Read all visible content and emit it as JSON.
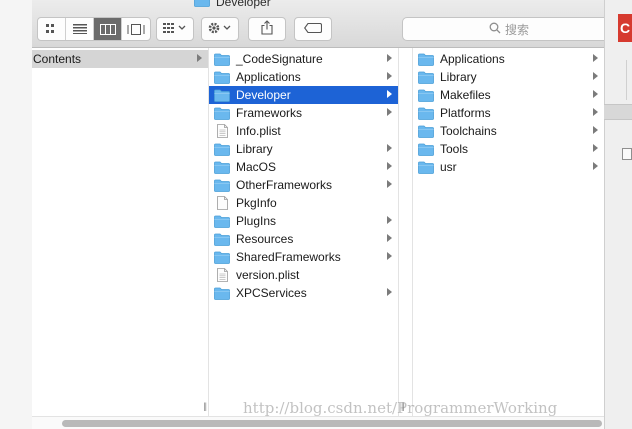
{
  "window": {
    "title": "Developer"
  },
  "toolbar": {
    "view_buttons": [
      {
        "icon": "icon-view-icon",
        "active": false
      },
      {
        "icon": "list-view-icon",
        "active": false
      },
      {
        "icon": "column-view-icon",
        "active": true
      },
      {
        "icon": "gallery-view-icon",
        "active": false
      }
    ],
    "arrange_icon": "group-arrange-icon",
    "action_icon": "gear-icon",
    "share_icon": "share-icon",
    "tag_icon": "tag-icon",
    "search": {
      "placeholder": "搜索",
      "icon": "search-icon"
    }
  },
  "columns": [
    {
      "items": [
        {
          "name": "Contents",
          "type": "folder",
          "has_children": true,
          "state": "path"
        }
      ]
    },
    {
      "items": [
        {
          "name": "_CodeSignature",
          "type": "folder",
          "has_children": true
        },
        {
          "name": "Applications",
          "type": "folder",
          "has_children": true
        },
        {
          "name": "Developer",
          "type": "folder",
          "has_children": true,
          "state": "selected"
        },
        {
          "name": "Frameworks",
          "type": "folder",
          "has_children": true
        },
        {
          "name": "Info.plist",
          "type": "plist",
          "has_children": false
        },
        {
          "name": "Library",
          "type": "folder",
          "has_children": true
        },
        {
          "name": "MacOS",
          "type": "folder",
          "has_children": true
        },
        {
          "name": "OtherFrameworks",
          "type": "folder",
          "has_children": true
        },
        {
          "name": "PkgInfo",
          "type": "file",
          "has_children": false
        },
        {
          "name": "PlugIns",
          "type": "folder",
          "has_children": true
        },
        {
          "name": "Resources",
          "type": "folder",
          "has_children": true
        },
        {
          "name": "SharedFrameworks",
          "type": "folder",
          "has_children": true
        },
        {
          "name": "version.plist",
          "type": "plist",
          "has_children": false
        },
        {
          "name": "XPCServices",
          "type": "folder",
          "has_children": true
        }
      ]
    },
    {
      "items": [
        {
          "name": "Applications",
          "type": "folder",
          "has_children": true
        },
        {
          "name": "Library",
          "type": "folder",
          "has_children": true
        },
        {
          "name": "Makefiles",
          "type": "folder",
          "has_children": true
        },
        {
          "name": "Platforms",
          "type": "folder",
          "has_children": true
        },
        {
          "name": "Toolchains",
          "type": "folder",
          "has_children": true
        },
        {
          "name": "Tools",
          "type": "folder",
          "has_children": true
        },
        {
          "name": "usr",
          "type": "folder",
          "has_children": true
        }
      ]
    }
  ],
  "background_window": {
    "visible_letter": "C"
  },
  "watermark": "http://blog.csdn.net/ProgrammerWorking",
  "colors": {
    "selection": "#1d63d6",
    "folder": "#6ab8ee",
    "path": "#d5d5d5"
  }
}
